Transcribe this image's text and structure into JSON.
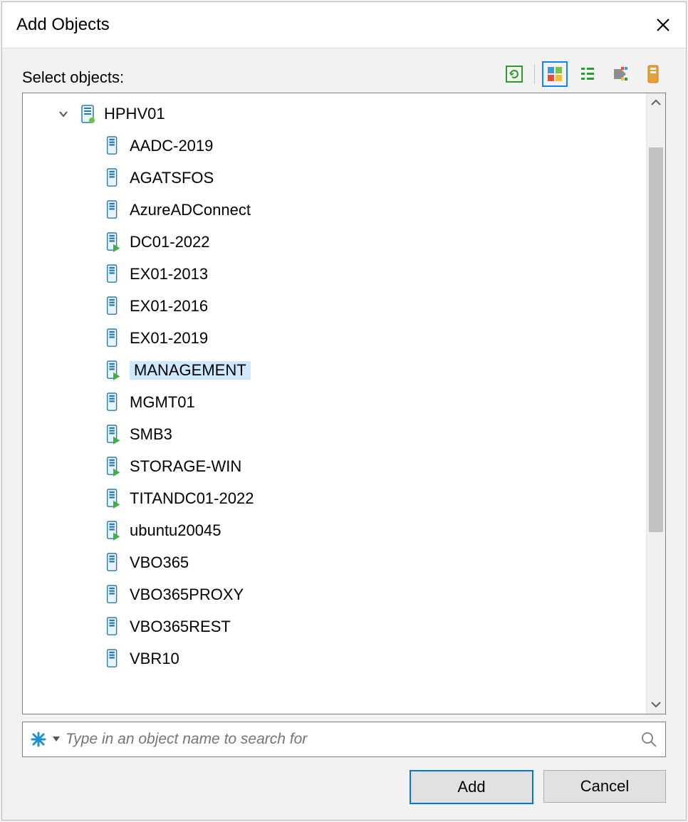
{
  "dialog": {
    "title": "Add Objects"
  },
  "header": {
    "select_label": "Select objects:"
  },
  "toolbar": {
    "buttons": [
      {
        "name": "refresh-button",
        "active": false
      },
      {
        "name": "view-hostsclusters-button",
        "active": true
      },
      {
        "name": "view-vmlist-button",
        "active": false
      },
      {
        "name": "view-tags-button",
        "active": false
      },
      {
        "name": "view-datastore-button",
        "active": false
      }
    ]
  },
  "tree": {
    "host": {
      "name": "HPHV01",
      "expanded": true
    },
    "vms": [
      {
        "label": "AADC-2019",
        "running": false,
        "selected": false
      },
      {
        "label": "AGATSFOS",
        "running": false,
        "selected": false
      },
      {
        "label": "AzureADConnect",
        "running": false,
        "selected": false
      },
      {
        "label": "DC01-2022",
        "running": true,
        "selected": false
      },
      {
        "label": "EX01-2013",
        "running": false,
        "selected": false
      },
      {
        "label": "EX01-2016",
        "running": false,
        "selected": false
      },
      {
        "label": "EX01-2019",
        "running": false,
        "selected": false
      },
      {
        "label": "MANAGEMENT",
        "running": true,
        "selected": true
      },
      {
        "label": "MGMT01",
        "running": false,
        "selected": false
      },
      {
        "label": "SMB3",
        "running": true,
        "selected": false
      },
      {
        "label": "STORAGE-WIN",
        "running": true,
        "selected": false
      },
      {
        "label": "TITANDC01-2022",
        "running": true,
        "selected": false
      },
      {
        "label": "ubuntu20045",
        "running": true,
        "selected": false
      },
      {
        "label": "VBO365",
        "running": false,
        "selected": false
      },
      {
        "label": "VBO365PROXY",
        "running": false,
        "selected": false
      },
      {
        "label": "VBO365REST",
        "running": false,
        "selected": false
      },
      {
        "label": "VBR10",
        "running": false,
        "selected": false
      }
    ]
  },
  "search": {
    "placeholder": "Type in an object name to search for",
    "value": ""
  },
  "buttons": {
    "add": "Add",
    "cancel": "Cancel"
  }
}
